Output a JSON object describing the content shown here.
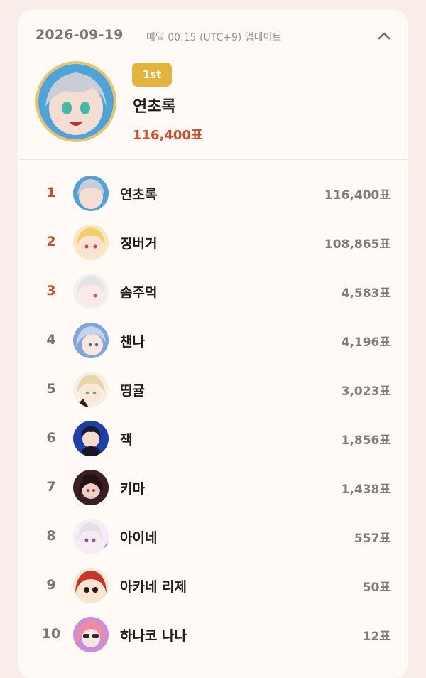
{
  "header": {
    "date": "2026-09-19",
    "update_note": "매일 00:15 (UTC+9) 업데이트"
  },
  "winner": {
    "badge": "1st",
    "name": "연초록",
    "votes": "116,400표"
  },
  "ranking": [
    {
      "rank": "1",
      "name": "연초록",
      "votes": "116,400표"
    },
    {
      "rank": "2",
      "name": "징버거",
      "votes": "108,865표"
    },
    {
      "rank": "3",
      "name": "솜주먹",
      "votes": "4,583표"
    },
    {
      "rank": "4",
      "name": "챈나",
      "votes": "4,196표"
    },
    {
      "rank": "5",
      "name": "띵귤",
      "votes": "3,023표"
    },
    {
      "rank": "6",
      "name": "잭",
      "votes": "1,856표"
    },
    {
      "rank": "7",
      "name": "키마",
      "votes": "1,438표"
    },
    {
      "rank": "8",
      "name": "아이네",
      "votes": "557표"
    },
    {
      "rank": "9",
      "name": "아카네 리제",
      "votes": "50표"
    },
    {
      "rank": "10",
      "name": "하나코 나나",
      "votes": "12표"
    }
  ],
  "colors": {
    "accent_red": "#cf4a2e",
    "gold": "#e2b43c",
    "background": "#f9eee7",
    "card": "#fffaf5"
  },
  "icons": {
    "collapse": "chevron-up-icon"
  }
}
